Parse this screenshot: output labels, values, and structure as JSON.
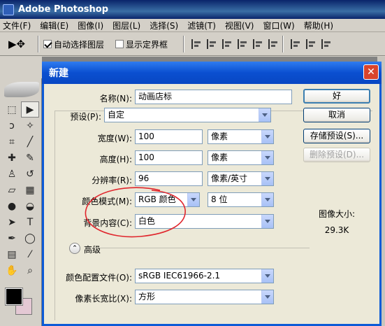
{
  "app": {
    "title": "Adobe Photoshop"
  },
  "menubar": [
    "文件(F)",
    "编辑(E)",
    "图像(I)",
    "图层(L)",
    "选择(S)",
    "滤镜(T)",
    "视图(V)",
    "窗口(W)",
    "帮助(H)"
  ],
  "options": {
    "auto_select_label": "自动选择图层",
    "auto_select_checked": true,
    "show_bounds_label": "显示定界框",
    "show_bounds_checked": false
  },
  "dialog": {
    "title": "新建",
    "close_glyph": "✕",
    "name_label": "名称(N):",
    "name_value": "动画店标",
    "preset_label": "预设(P):",
    "preset_value": "自定",
    "width_label": "宽度(W):",
    "width_value": "100",
    "width_unit": "像素",
    "height_label": "高度(H):",
    "height_value": "100",
    "height_unit": "像素",
    "resolution_label": "分辨率(R):",
    "resolution_value": "96",
    "resolution_unit": "像素/英寸",
    "color_mode_label": "颜色模式(M):",
    "color_mode_value": "RGB 颜色",
    "bit_depth_value": "8 位",
    "bg_contents_label": "背景内容(C):",
    "bg_contents_value": "白色",
    "advanced_label": "高级",
    "color_profile_label": "颜色配置文件(O):",
    "color_profile_value": "sRGB IEC61966-2.1",
    "pixel_aspect_label": "像素长宽比(X):",
    "pixel_aspect_value": "方形",
    "buttons": {
      "ok": "好",
      "cancel": "取消",
      "save_preset": "存储预设(S)...",
      "delete_preset": "删除预设(D)..."
    },
    "image_size_label": "图像大小:",
    "image_size_value": "29.3K"
  },
  "colors": {
    "annotation": "#e0262d",
    "dialog_title": "#0a4fd0",
    "foreground": "#000000",
    "background": "#e4c8d4"
  }
}
